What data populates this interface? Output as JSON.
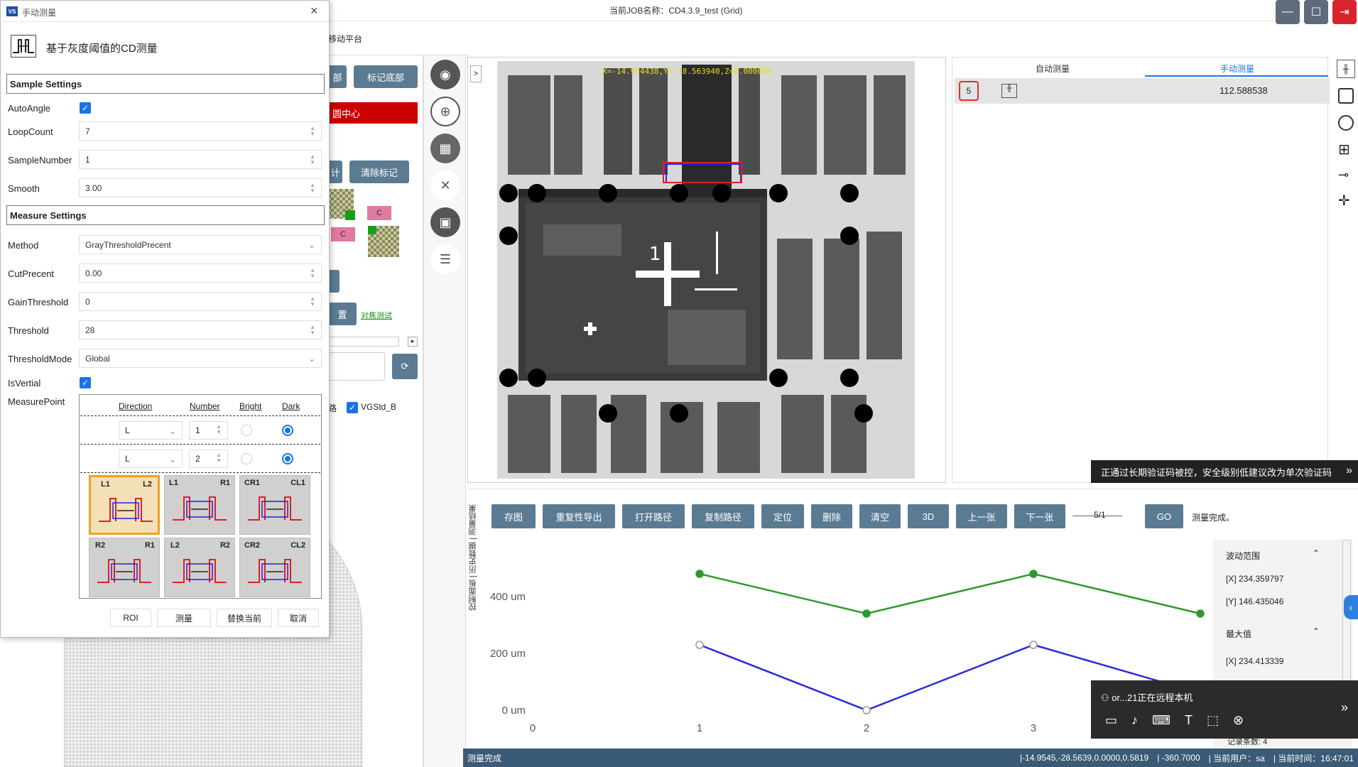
{
  "window": {
    "job_title": "当前JOB名称：CD4.3.9_test (Grid)",
    "controls": {
      "minimize": "minimize-icon",
      "maximize": "maximize-icon",
      "exit": "exit-icon"
    }
  },
  "background": {
    "move_platform": "移动平台",
    "btn_part": "部",
    "btn_mark_bottom": "标记底部",
    "btn_circle_center": "圆中心",
    "btn_partial2": "计",
    "btn_clear_marks": "清除标记",
    "chip_c1": "C",
    "chip_c2": "C",
    "btn_set": "置",
    "link_focus": "对焦测试",
    "route_label": "路",
    "vgstd_label": "VGStd_B"
  },
  "viewer": {
    "toggle": ">",
    "coord_overlay": "X=-14.954438,Y=-28.563940,Z=0.000000"
  },
  "right_panel": {
    "tab_auto": "自动测量",
    "tab_manual": "手动测量",
    "row_index": "5",
    "row_value": "112.588538",
    "notice": "正通过长期验证码被控，安全级别低建议改为单次验证码"
  },
  "bottom": {
    "side_tabs": [
      "测量结果",
      "历史数据",
      "控制面板"
    ],
    "buttons": [
      "存图",
      "重复性导出",
      "打开路径",
      "复制路径",
      "定位",
      "删除",
      "清空",
      "3D",
      "上一张",
      "下一张"
    ],
    "page": "5/1",
    "go": "GO",
    "status_msg": "测量完成。",
    "stats": {
      "range_title": "波动范围",
      "range_x": "[X]   234.359797",
      "range_y": "[Y]   146.435046",
      "max_title": "最大值",
      "max_x": "[X]   234.413339",
      "count": "记录条数: 4"
    },
    "remote": {
      "text": "or...21正在远程本机"
    }
  },
  "chart_data": {
    "type": "line",
    "x": [
      1,
      2,
      3,
      4
    ],
    "x_ticks": [
      "0",
      "1",
      "2",
      "3"
    ],
    "y_ticks": [
      "0 um",
      "200 um",
      "400 um"
    ],
    "ylim": [
      0,
      550
    ],
    "xlim": [
      0,
      4
    ],
    "series": [
      {
        "values": [
          480,
          340,
          480,
          340
        ],
        "color": "#2e9a2e"
      },
      {
        "values": [
          230,
          0,
          230,
          60
        ],
        "color": "#2b2bd6"
      }
    ],
    "grid": false
  },
  "statusbar": {
    "left": "测量完成",
    "coords": "|-14.9545,-28.5639,0.0000,0.5819",
    "angle": "| -360.7000",
    "user": "| 当前用户：sa",
    "time": "| 当前时间：16:47:01"
  },
  "dialog": {
    "title": "手动测量",
    "close": "×",
    "header": "基于灰度阈值的CD测量",
    "sample_section": "Sample Settings",
    "auto_angle_label": "AutoAngle",
    "loop_count_label": "LoopCount",
    "loop_count": "7",
    "sample_number_label": "SampleNumber",
    "sample_number": "1",
    "smooth_label": "Smooth",
    "smooth": "3.00",
    "measure_section": "Measure Settings",
    "method_label": "Method",
    "method": "GrayThresholdPrecent",
    "cut_label": "CutPrecent",
    "cut": "0.00",
    "gain_label": "GainThreshold",
    "gain": "0",
    "threshold_label": "Threshold",
    "threshold": "28",
    "threshold_mode_label": "ThresholdMode",
    "threshold_mode": "Global",
    "is_vertial_label": "IsVertial",
    "measure_point_label": "MeasurePoint",
    "mp_headers": [
      "Direction",
      "Number",
      "Bright",
      "Dark"
    ],
    "mp_rows": [
      {
        "dir": "L",
        "num": "1"
      },
      {
        "dir": "L",
        "num": "2"
      }
    ],
    "tiles": [
      {
        "a": "L1",
        "b": "L2"
      },
      {
        "a": "L1",
        "b": "R1"
      },
      {
        "a": "CR1",
        "b": "CL1"
      },
      {
        "a": "R2",
        "b": "R1"
      },
      {
        "a": "L2",
        "b": "R2"
      },
      {
        "a": "CR2",
        "b": "CL2"
      }
    ],
    "btn_roi": "ROI",
    "btn_measure": "测量",
    "btn_replace": "替换当前",
    "btn_cancel": "取消"
  }
}
